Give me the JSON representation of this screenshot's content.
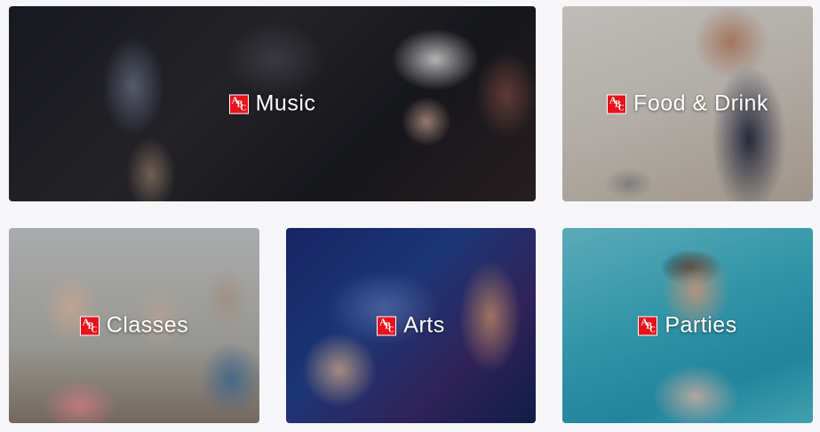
{
  "categories": [
    {
      "label": "Music",
      "icon": "abc-icon"
    },
    {
      "label": "Food & Drink",
      "icon": "abc-icon"
    },
    {
      "label": "Classes",
      "icon": "abc-icon"
    },
    {
      "label": "Arts",
      "icon": "abc-icon"
    },
    {
      "label": "Parties",
      "icon": "abc-icon"
    }
  ],
  "colors": {
    "page_background": "#f6f6f8",
    "label_text": "#ffffff",
    "icon_background": "#e8121b"
  }
}
